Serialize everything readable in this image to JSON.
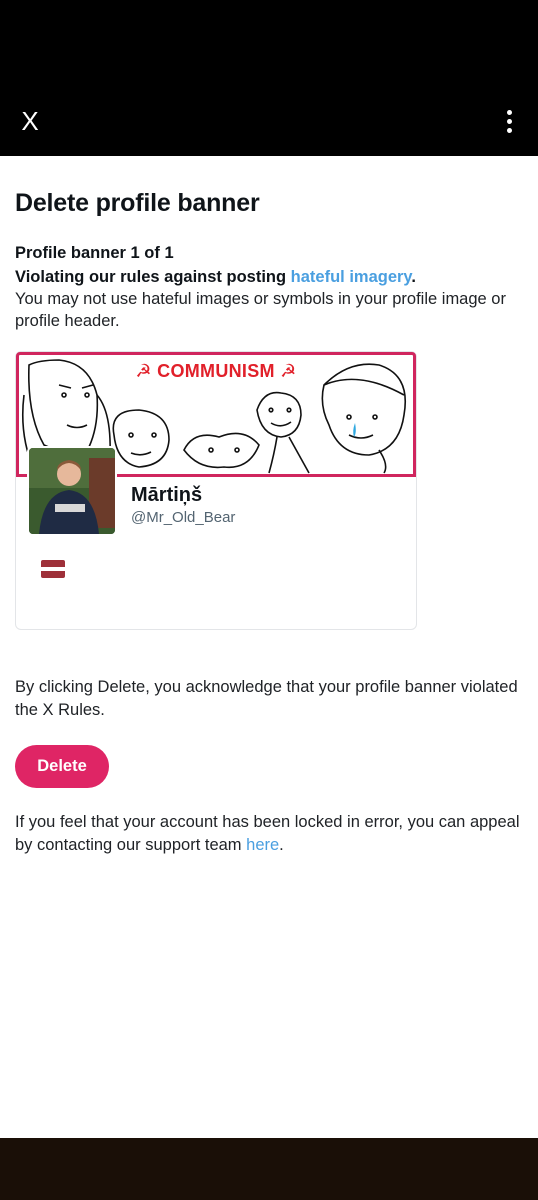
{
  "topbar": {
    "close_label": "X",
    "more_icon": "more-vertical-icon"
  },
  "page": {
    "title": "Delete profile banner",
    "banner_count": "Profile banner 1 of 1",
    "rule_prefix": "Violating our rules against posting ",
    "rule_link": "hateful imagery",
    "rule_suffix": ".",
    "rule_description": "You may not use hateful images or symbols in your profile image or profile header."
  },
  "profile_card": {
    "banner_caption": "☭ COMMUNISM ☭",
    "display_name": "Mārtiņš",
    "handle": "@Mr_Old_Bear",
    "flag": "latvia-flag",
    "colors": {
      "banner_border": "#d0265e",
      "flag_red": "#9e3039"
    }
  },
  "acknowledge_text": "By clicking Delete, you acknowledge that your profile banner violated the X Rules.",
  "delete_button": {
    "label": "Delete",
    "color": "#df2565"
  },
  "appeal": {
    "text": "If you feel that your account has been locked in error, you can appeal by contacting our support team ",
    "link": "here",
    "suffix": "."
  },
  "colors": {
    "link": "#4a9fe0",
    "topbar": "#000000"
  }
}
